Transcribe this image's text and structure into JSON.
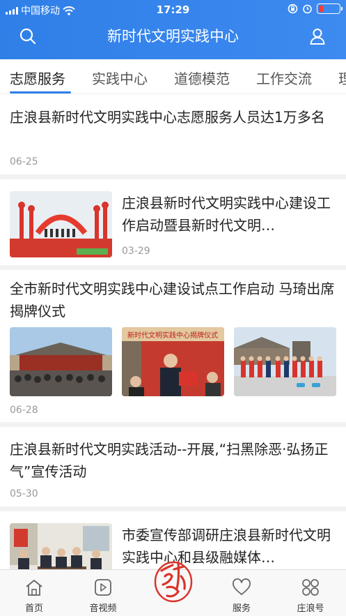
{
  "status": {
    "carrier": "中国移动",
    "time": "17:29"
  },
  "header": {
    "title": "新时代文明实践中心"
  },
  "tabs": [
    {
      "label": "志愿服务"
    },
    {
      "label": "实践中心"
    },
    {
      "label": "道德模范"
    },
    {
      "label": "工作交流"
    },
    {
      "label": "理"
    }
  ],
  "feed": [
    {
      "title": "庄浪县新时代文明实践中心志愿服务人员达1万多名",
      "date": "06-25"
    },
    {
      "title": "庄浪县新时代文明实践中心建设工作启动暨县新时代文明…",
      "date": "03-29"
    },
    {
      "title": "全市新时代文明实践中心建设试点工作启动 马琦出席揭牌仪式",
      "date": "06-28",
      "banner_text": "新时代文明实践中心揭牌仪式"
    },
    {
      "title": "庄浪县新时代文明实践活动--开展,“扫黑除恶·弘扬正气”宣传活动",
      "date": "05-30"
    },
    {
      "title": "市委宣传部调研庄浪县新时代文明实践中心和县级融媒体…"
    }
  ],
  "tabbar": [
    {
      "label": "首页",
      "icon": "home-icon"
    },
    {
      "label": "音视频",
      "icon": "play-icon"
    },
    {
      "label": "服务",
      "icon": "heart-icon"
    },
    {
      "label": "庄浪号",
      "icon": "clover-icon"
    }
  ],
  "colors": {
    "accent": "#2f7fe8",
    "logo_red": "#d9342b"
  }
}
